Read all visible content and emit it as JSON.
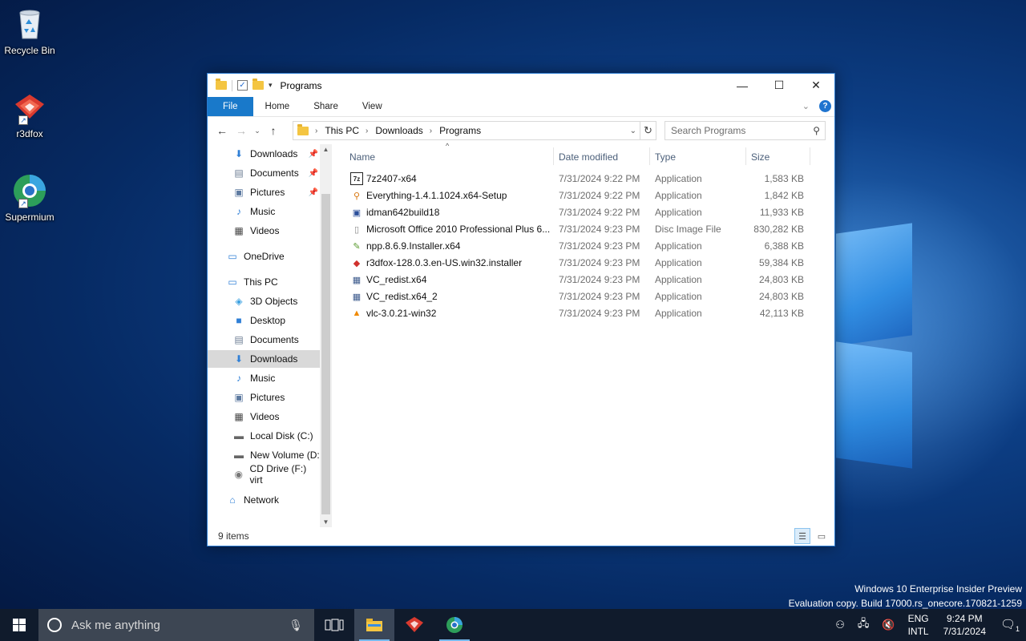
{
  "desktop": {
    "icons": [
      {
        "label": "Recycle Bin",
        "icon": "recycle-bin-icon"
      },
      {
        "label": "r3dfox",
        "icon": "r3dfox-icon"
      },
      {
        "label": "Supermium",
        "icon": "supermium-icon"
      }
    ],
    "watermark": {
      "line1": "Windows 10 Enterprise Insider Preview",
      "line2": "Evaluation copy. Build 17000.rs_onecore.170821-1259"
    }
  },
  "window": {
    "title": "Programs",
    "caption": {
      "minimize": "—",
      "maximize": "☐",
      "close": "✕"
    },
    "ribbon": {
      "tabs": [
        "File",
        "Home",
        "Share",
        "View"
      ],
      "help": "?"
    },
    "nav": {
      "back": "←",
      "forward": "→",
      "recent": "⌄",
      "up": "↑"
    },
    "address": {
      "crumbs": [
        "This PC",
        "Downloads",
        "Programs"
      ]
    },
    "search": {
      "placeholder": "Search Programs"
    },
    "navpane": {
      "quick_access": [
        {
          "label": "Downloads",
          "icon": "download-arrow-icon",
          "pinned": true
        },
        {
          "label": "Documents",
          "icon": "documents-icon",
          "pinned": true
        },
        {
          "label": "Pictures",
          "icon": "pictures-icon",
          "pinned": true
        },
        {
          "label": "Music",
          "icon": "music-icon",
          "pinned": false
        },
        {
          "label": "Videos",
          "icon": "videos-icon",
          "pinned": false
        }
      ],
      "onedrive": "OneDrive",
      "this_pc": "This PC",
      "this_pc_items": [
        {
          "label": "3D Objects",
          "icon": "3d-objects-icon"
        },
        {
          "label": "Desktop",
          "icon": "desktop-icon"
        },
        {
          "label": "Documents",
          "icon": "documents-icon"
        },
        {
          "label": "Downloads",
          "icon": "download-arrow-icon",
          "selected": true
        },
        {
          "label": "Music",
          "icon": "music-icon"
        },
        {
          "label": "Pictures",
          "icon": "pictures-icon"
        },
        {
          "label": "Videos",
          "icon": "videos-icon"
        },
        {
          "label": "Local Disk (C:)",
          "icon": "local-disk-icon"
        },
        {
          "label": "New Volume (D:",
          "icon": "drive-icon"
        },
        {
          "label": "CD Drive (F:) virt",
          "icon": "cd-drive-icon"
        }
      ],
      "network": "Network"
    },
    "columns": {
      "name": "Name",
      "date": "Date modified",
      "type": "Type",
      "size": "Size"
    },
    "files": [
      {
        "name": "7z2407-x64",
        "date": "7/31/2024 9:22 PM",
        "type": "Application",
        "size": "1,583 KB",
        "icon": "7zip-icon",
        "color": "#222222"
      },
      {
        "name": "Everything-1.4.1.1024.x64-Setup",
        "date": "7/31/2024 9:22 PM",
        "type": "Application",
        "size": "1,842 KB",
        "icon": "magnifier-icon",
        "color": "#d8760e"
      },
      {
        "name": "idman642build18",
        "date": "7/31/2024 9:22 PM",
        "type": "Application",
        "size": "11,933 KB",
        "icon": "idm-icon",
        "color": "#2b4f9b"
      },
      {
        "name": "Microsoft Office 2010 Professional Plus 6...",
        "date": "7/31/2024 9:23 PM",
        "type": "Disc Image File",
        "size": "830,282 KB",
        "icon": "disc-image-icon",
        "color": "#8a8a8a"
      },
      {
        "name": "npp.8.6.9.Installer.x64",
        "date": "7/31/2024 9:23 PM",
        "type": "Application",
        "size": "6,388 KB",
        "icon": "notepad-plus-plus-icon",
        "color": "#5a9a2e"
      },
      {
        "name": "r3dfox-128.0.3.en-US.win32.installer",
        "date": "7/31/2024 9:23 PM",
        "type": "Application",
        "size": "59,384 KB",
        "icon": "r3dfox-icon",
        "color": "#d0312d"
      },
      {
        "name": "VC_redist.x64",
        "date": "7/31/2024 9:23 PM",
        "type": "Application",
        "size": "24,803 KB",
        "icon": "installer-icon",
        "color": "#3c5a8c"
      },
      {
        "name": "VC_redist.x64_2",
        "date": "7/31/2024 9:23 PM",
        "type": "Application",
        "size": "24,803 KB",
        "icon": "installer-icon",
        "color": "#3c5a8c"
      },
      {
        "name": "vlc-3.0.21-win32",
        "date": "7/31/2024 9:23 PM",
        "type": "Application",
        "size": "42,113 KB",
        "icon": "vlc-icon",
        "color": "#f08a00"
      }
    ],
    "status": "9 items"
  },
  "taskbar": {
    "search_placeholder": "Ask me anything",
    "lang": {
      "line1": "ENG",
      "line2": "INTL"
    },
    "clock": {
      "time": "9:24 PM",
      "date": "7/31/2024"
    },
    "notifications": "1"
  },
  "colors": {
    "accent": "#1979ca",
    "taskbar": "#101b2c",
    "selection": "#d9d9d9"
  }
}
